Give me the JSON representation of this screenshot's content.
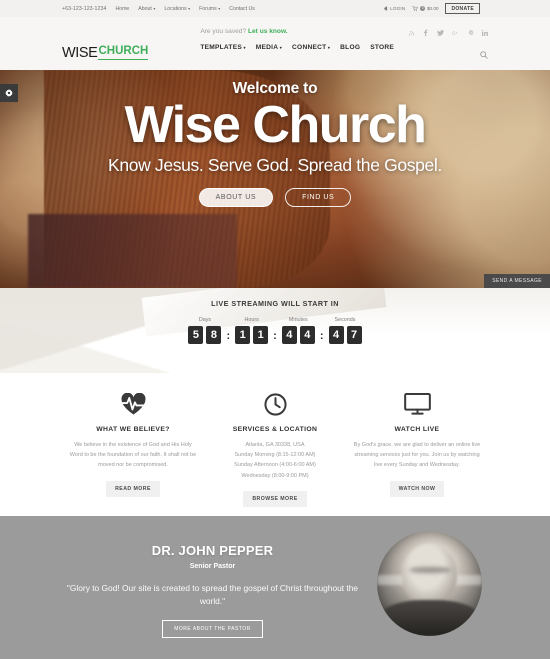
{
  "topbar": {
    "phone": "+63-123-123-1234",
    "nav": [
      {
        "label": "Home",
        "has_caret": false
      },
      {
        "label": "About",
        "has_caret": true
      },
      {
        "label": "Locations",
        "has_caret": true
      },
      {
        "label": "Forums",
        "has_caret": true
      },
      {
        "label": "Contact Us",
        "has_caret": false
      }
    ],
    "login_label": "LOGIN",
    "cart_count": "0",
    "cart_total": "$0.00",
    "donate_label": "DONATE"
  },
  "header": {
    "logo_primary": "WISE",
    "logo_secondary": "CHURCH",
    "tagline_plain": "Are you saved?",
    "tagline_link": "Let us know.",
    "nav": [
      {
        "label": "TEMPLATES",
        "has_caret": true
      },
      {
        "label": "MEDIA",
        "has_caret": true
      },
      {
        "label": "CONNECT",
        "has_caret": true
      },
      {
        "label": "BLOG",
        "has_caret": false
      },
      {
        "label": "STORE",
        "has_caret": false
      }
    ],
    "social": [
      {
        "name": "rss-icon",
        "glyph": "➤"
      },
      {
        "name": "facebook-icon",
        "glyph": "f"
      },
      {
        "name": "twitter-icon",
        "glyph": "ᴠ"
      },
      {
        "name": "google-plus-icon",
        "glyph": "G+"
      },
      {
        "name": "pinterest-icon",
        "glyph": "Ⓟ"
      },
      {
        "name": "linkedin-icon",
        "glyph": "in"
      }
    ],
    "search_glyph": "⌕"
  },
  "hero": {
    "welcome": "Welcome to",
    "title": "Wise Church",
    "subtitle": "Know Jesus. Serve God. Spread the Gospel.",
    "btn_primary": "ABOUT US",
    "btn_secondary": "FIND US",
    "settings_glyph": "⚙",
    "send_message_label": "SEND A MESSAGE"
  },
  "countdown": {
    "title": "LIVE STREAMING WILL START IN",
    "separator": ":",
    "groups": [
      {
        "label": "Days",
        "digits": [
          "5",
          "8"
        ]
      },
      {
        "label": "Hours",
        "digits": [
          "1",
          "1"
        ]
      },
      {
        "label": "Minutes",
        "digits": [
          "4",
          "4"
        ]
      },
      {
        "label": "Seconds",
        "digits": [
          "4",
          "7"
        ]
      }
    ]
  },
  "features": [
    {
      "icon": "heartbeat-icon",
      "title": "WHAT WE BELIEVE?",
      "text": "We believe in the existence of God and His Holy Word to be the foundation of our faith. It shall not be moved nor be compromised.",
      "button": "READ MORE"
    },
    {
      "icon": "clock-icon",
      "title": "SERVICES & LOCATION",
      "text": "Atlanta, GA 30338, USA\nSunday Morning (8:15-12:00 AM)\nSunday Afternoon (4:00-6:00 AM)\nWednesday (8:00-9:00 PM)",
      "button": "BROWSE MORE"
    },
    {
      "icon": "monitor-icon",
      "title": "WATCH LIVE",
      "text": "By God's grace, we are glad to deliver an online live streaming services just for you. Join us by watching live every Sunday and Wednesday.",
      "button": "WATCH NOW"
    }
  ],
  "pastor": {
    "name": "DR. JOHN PEPPER",
    "role": "Senior Pastor",
    "quote": "\"Glory to God! Our site is created to spread the gospel of Christ throughout the world.\"",
    "button": "MORE ABOUT THE PASTOR",
    "photo_alt": "pastor-portrait"
  },
  "colors": {
    "brand_green": "#3fae5a",
    "topbar_bg": "#f2f1ef",
    "header_bg": "#f7f6f4",
    "pastor_bg": "#9b9b9b",
    "countdown_box": "#2d2d2d"
  }
}
